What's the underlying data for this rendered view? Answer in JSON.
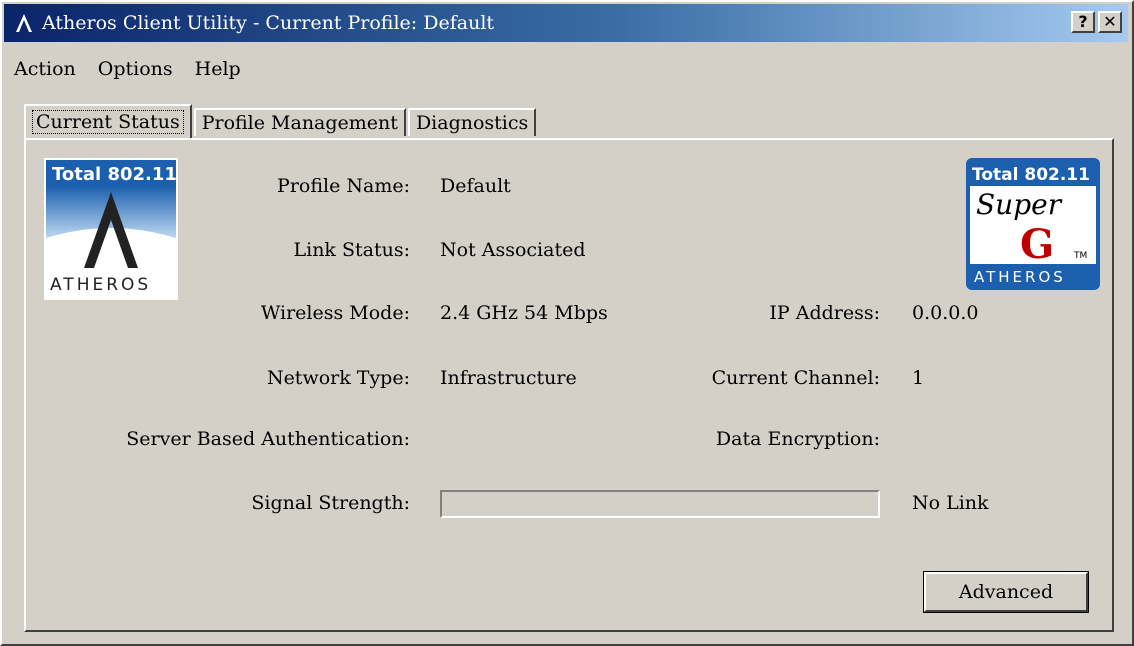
{
  "window": {
    "title": "Atheros Client Utility - Current Profile: Default",
    "help_button": "?",
    "close_button": "✕"
  },
  "menu": {
    "items": [
      {
        "label": "Action"
      },
      {
        "label": "Options"
      },
      {
        "label": "Help"
      }
    ]
  },
  "tabs": [
    {
      "label": "Current Status",
      "active": true
    },
    {
      "label": "Profile Management",
      "active": false
    },
    {
      "label": "Diagnostics",
      "active": false
    }
  ],
  "logos": {
    "left": {
      "line1": "Total 802.11",
      "brand": "ATHEROS"
    },
    "right": {
      "line1": "Total 802.11",
      "line2": "Super",
      "line3": "G",
      "brand": "ATHEROS",
      "tm": "TM"
    }
  },
  "status": {
    "profile_name_label": "Profile Name:",
    "profile_name": "Default",
    "link_status_label": "Link Status:",
    "link_status": "Not Associated",
    "wireless_mode_label": "Wireless Mode:",
    "wireless_mode": "2.4 GHz 54 Mbps",
    "ip_address_label": "IP Address:",
    "ip_address": "0.0.0.0",
    "network_type_label": "Network Type:",
    "network_type": "Infrastructure",
    "current_channel_label": "Current Channel:",
    "current_channel": "1",
    "server_auth_label": "Server Based Authentication:",
    "server_auth": "",
    "data_encryption_label": "Data Encryption:",
    "data_encryption": "",
    "signal_strength_label": "Signal Strength:",
    "signal_strength_percent": 0,
    "signal_text": "No Link"
  },
  "buttons": {
    "advanced": "Advanced"
  },
  "colors": {
    "title_gradient_start": "#0a246a",
    "title_gradient_end": "#a6caf0",
    "logo_blue": "#1c5fae"
  }
}
